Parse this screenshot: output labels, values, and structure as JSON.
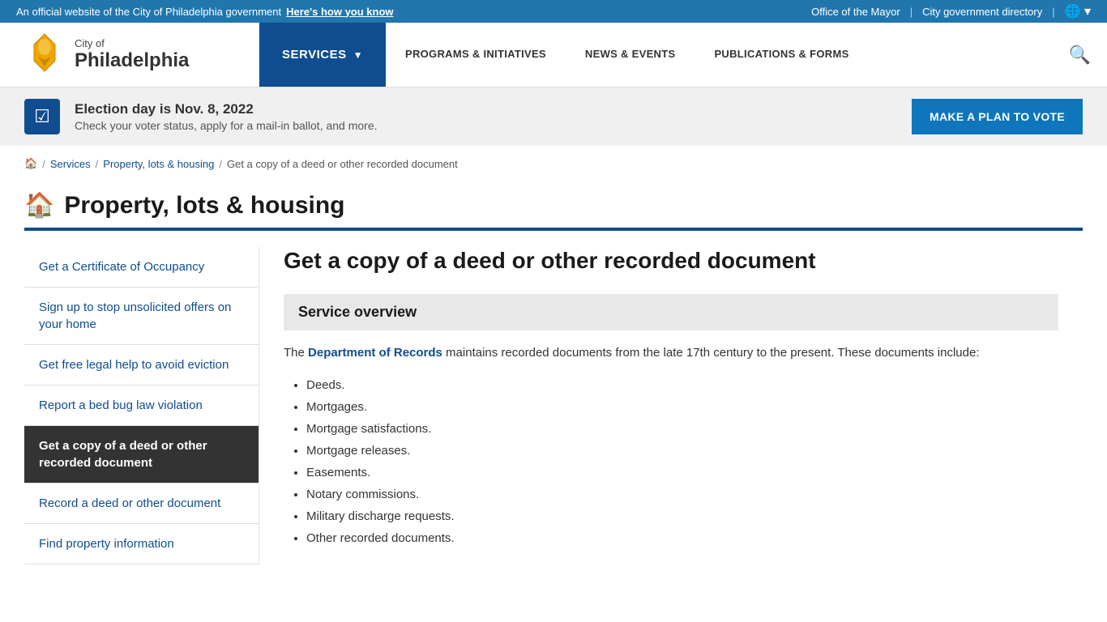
{
  "topbar": {
    "official_text": "An official website of the City of Philadelphia government",
    "how_to_know": "Here's how you know",
    "mayor": "Office of the Mayor",
    "city_directory": "City government directory",
    "accent_color": "#2176ae"
  },
  "header": {
    "logo_city": "City of",
    "logo_philly": "Philadelphia",
    "nav_services": "SERVICES",
    "nav_programs": "PROGRAMS & INITIATIVES",
    "nav_news": "NEWS & EVENTS",
    "nav_publications": "PUBLICATIONS & FORMS"
  },
  "election_banner": {
    "title": "Election day is Nov. 8, 2022",
    "subtitle": "Check your voter status, apply for a mail-in ballot, and more.",
    "button": "MAKE A PLAN TO VOTE"
  },
  "breadcrumb": {
    "home": "🏠",
    "services": "Services",
    "property": "Property, lots & housing",
    "current": "Get a copy of a deed or other recorded document"
  },
  "page": {
    "category_title": "Property, lots & housing",
    "main_title": "Get a copy of a deed or other recorded document"
  },
  "sidebar": {
    "items": [
      {
        "label": "Get a Certificate of Occupancy",
        "active": false
      },
      {
        "label": "Sign up to stop unsolicited offers on your home",
        "active": false
      },
      {
        "label": "Get free legal help to avoid eviction",
        "active": false
      },
      {
        "label": "Report a bed bug law violation",
        "active": false
      },
      {
        "label": "Get a copy of a deed or other recorded document",
        "active": true
      },
      {
        "label": "Record a deed or other document",
        "active": false
      },
      {
        "label": "Find property information",
        "active": false
      }
    ]
  },
  "service_overview": {
    "title": "Service overview",
    "description_part1": "The ",
    "dept_link_text": "Department of Records",
    "description_part2": " maintains recorded documents from the late 17th century to the present. These documents include:",
    "list_items": [
      "Deeds.",
      "Mortgages.",
      "Mortgage satisfactions.",
      "Mortgage releases.",
      "Easements.",
      "Notary commissions.",
      "Military discharge requests.",
      "Other recorded documents."
    ]
  }
}
